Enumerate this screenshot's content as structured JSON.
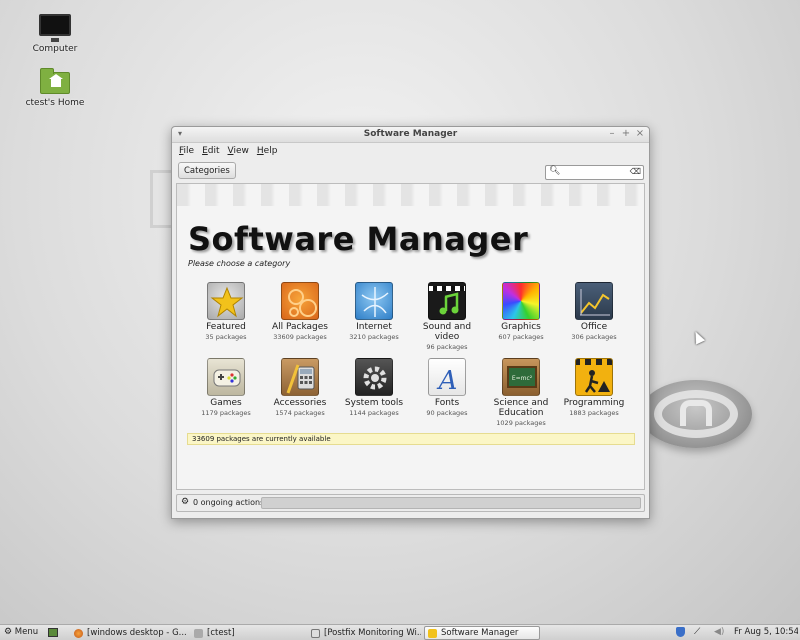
{
  "desktop": {
    "icons": [
      {
        "label": "Computer"
      },
      {
        "label": "ctest's Home"
      }
    ]
  },
  "window": {
    "title": "Software Manager",
    "menu": [
      "File",
      "Edit",
      "View",
      "Help"
    ],
    "toolbar": {
      "categories_label": "Categories",
      "search_value": ""
    },
    "heading": "Software Manager",
    "subtitle": "Please choose a category",
    "categories": [
      {
        "name": "Featured",
        "count": "35 packages",
        "icon": "featured-star-icon"
      },
      {
        "name": "All Packages",
        "count": "33609 packages",
        "icon": "all-packages-icon"
      },
      {
        "name": "Internet",
        "count": "3210 packages",
        "icon": "internet-icon"
      },
      {
        "name": "Sound and video",
        "count": "96 packages",
        "icon": "sound-video-icon"
      },
      {
        "name": "Graphics",
        "count": "607 packages",
        "icon": "graphics-icon"
      },
      {
        "name": "Office",
        "count": "306 packages",
        "icon": "office-icon"
      },
      {
        "name": "Games",
        "count": "1179 packages",
        "icon": "games-icon"
      },
      {
        "name": "Accessories",
        "count": "1574 packages",
        "icon": "accessories-icon"
      },
      {
        "name": "System tools",
        "count": "1144 packages",
        "icon": "system-tools-icon"
      },
      {
        "name": "Fonts",
        "count": "90 packages",
        "icon": "fonts-icon"
      },
      {
        "name": "Science and Education",
        "count": "1029 packages",
        "icon": "science-education-icon"
      },
      {
        "name": "Programming",
        "count": "1883 packages",
        "icon": "programming-icon"
      }
    ],
    "status": "33609 packages are currently available",
    "footer": {
      "actions": "0 ongoing actions"
    }
  },
  "taskbar": {
    "menu_label": "Menu",
    "tasks": [
      {
        "label": "[windows desktop - G..."
      },
      {
        "label": "[ctest]"
      },
      {
        "label": "[Postfix Monitoring Wi..."
      },
      {
        "label": "Software Manager"
      }
    ],
    "clock": "Fr Aug  5, 10:54"
  }
}
